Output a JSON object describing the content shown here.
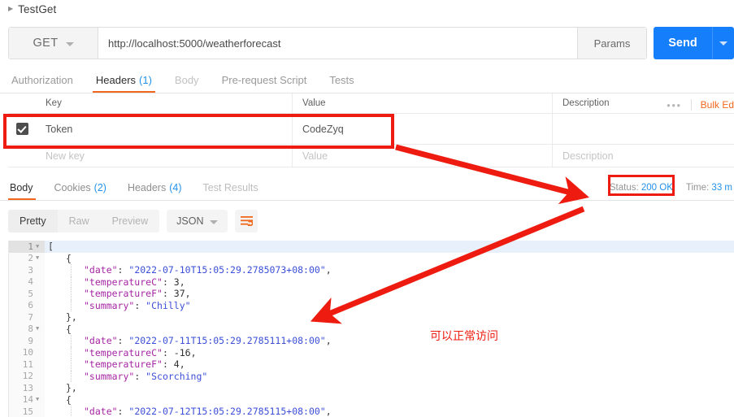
{
  "tabstrip": {
    "caret": "collapse-caret-icon",
    "title": "TestGet"
  },
  "urlbar": {
    "method": "GET",
    "method_caret": "chevron-down-icon",
    "url": "http://localhost:5000/weatherforecast",
    "params_label": "Params",
    "send_label": "Send",
    "send_caret": "chevron-down-icon"
  },
  "request_tabs": [
    {
      "label": "Authorization",
      "count": "",
      "active": false,
      "dim": false
    },
    {
      "label": "Headers",
      "count": "(1)",
      "active": true,
      "dim": false
    },
    {
      "label": "Body",
      "count": "",
      "active": false,
      "dim": true
    },
    {
      "label": "Pre-request Script",
      "count": "",
      "active": false,
      "dim": false
    },
    {
      "label": "Tests",
      "count": "",
      "active": false,
      "dim": false
    }
  ],
  "headers_table": {
    "columns": {
      "key": "Key",
      "value": "Value",
      "description": "Description"
    },
    "more_icon": "ellipsis-icon",
    "bulk_edit_label": "Bulk Ed",
    "rows": [
      {
        "checked": true,
        "key": "Token",
        "value": "CodeZyq",
        "description": ""
      }
    ],
    "new_row": {
      "key_placeholder": "New key",
      "value_placeholder": "Value",
      "description_placeholder": "Description"
    }
  },
  "response_tabs": [
    {
      "label": "Body",
      "count": "",
      "active": true,
      "dim": false
    },
    {
      "label": "Cookies",
      "count": "(2)",
      "active": false,
      "dim": false
    },
    {
      "label": "Headers",
      "count": "(4)",
      "active": false,
      "dim": false
    },
    {
      "label": "Test Results",
      "count": "",
      "active": false,
      "dim": true
    }
  ],
  "response_meta": {
    "status_label": "Status:",
    "status_value": "200 OK",
    "time_label": "Time:",
    "time_value": "33 m"
  },
  "format_bar": {
    "modes": [
      {
        "label": "Pretty",
        "active": true
      },
      {
        "label": "Raw",
        "active": false
      },
      {
        "label": "Preview",
        "active": false
      }
    ],
    "language": "JSON",
    "language_caret": "chevron-down-icon",
    "wrap_icon": "word-wrap-icon"
  },
  "code": {
    "lines": [
      {
        "num": "1",
        "fold": true,
        "highlight": true,
        "indent": 0,
        "tokens": [
          {
            "t": "p",
            "v": "["
          }
        ]
      },
      {
        "num": "2",
        "fold": true,
        "highlight": false,
        "indent": 1,
        "tokens": [
          {
            "t": "p",
            "v": "{"
          }
        ]
      },
      {
        "num": "3",
        "fold": false,
        "highlight": false,
        "indent": 2,
        "tokens": [
          {
            "t": "k",
            "v": "\"date\""
          },
          {
            "t": "p",
            "v": ": "
          },
          {
            "t": "s",
            "v": "\"2022-07-10T15:05:29.2785073+08:00\""
          },
          {
            "t": "p",
            "v": ","
          }
        ]
      },
      {
        "num": "4",
        "fold": false,
        "highlight": false,
        "indent": 2,
        "tokens": [
          {
            "t": "k",
            "v": "\"temperatureC\""
          },
          {
            "t": "p",
            "v": ": "
          },
          {
            "t": "n",
            "v": "3"
          },
          {
            "t": "p",
            "v": ","
          }
        ]
      },
      {
        "num": "5",
        "fold": false,
        "highlight": false,
        "indent": 2,
        "tokens": [
          {
            "t": "k",
            "v": "\"temperatureF\""
          },
          {
            "t": "p",
            "v": ": "
          },
          {
            "t": "n",
            "v": "37"
          },
          {
            "t": "p",
            "v": ","
          }
        ]
      },
      {
        "num": "6",
        "fold": false,
        "highlight": false,
        "indent": 2,
        "tokens": [
          {
            "t": "k",
            "v": "\"summary\""
          },
          {
            "t": "p",
            "v": ": "
          },
          {
            "t": "s",
            "v": "\"Chilly\""
          }
        ]
      },
      {
        "num": "7",
        "fold": false,
        "highlight": false,
        "indent": 1,
        "tokens": [
          {
            "t": "p",
            "v": "},"
          }
        ]
      },
      {
        "num": "8",
        "fold": true,
        "highlight": false,
        "indent": 1,
        "tokens": [
          {
            "t": "p",
            "v": "{"
          }
        ]
      },
      {
        "num": "9",
        "fold": false,
        "highlight": false,
        "indent": 2,
        "tokens": [
          {
            "t": "k",
            "v": "\"date\""
          },
          {
            "t": "p",
            "v": ": "
          },
          {
            "t": "s",
            "v": "\"2022-07-11T15:05:29.2785111+08:00\""
          },
          {
            "t": "p",
            "v": ","
          }
        ]
      },
      {
        "num": "10",
        "fold": false,
        "highlight": false,
        "indent": 2,
        "tokens": [
          {
            "t": "k",
            "v": "\"temperatureC\""
          },
          {
            "t": "p",
            "v": ": "
          },
          {
            "t": "n",
            "v": "-16"
          },
          {
            "t": "p",
            "v": ","
          }
        ]
      },
      {
        "num": "11",
        "fold": false,
        "highlight": false,
        "indent": 2,
        "tokens": [
          {
            "t": "k",
            "v": "\"temperatureF\""
          },
          {
            "t": "p",
            "v": ": "
          },
          {
            "t": "n",
            "v": "4"
          },
          {
            "t": "p",
            "v": ","
          }
        ]
      },
      {
        "num": "12",
        "fold": false,
        "highlight": false,
        "indent": 2,
        "tokens": [
          {
            "t": "k",
            "v": "\"summary\""
          },
          {
            "t": "p",
            "v": ": "
          },
          {
            "t": "s",
            "v": "\"Scorching\""
          }
        ]
      },
      {
        "num": "13",
        "fold": false,
        "highlight": false,
        "indent": 1,
        "tokens": [
          {
            "t": "p",
            "v": "},"
          }
        ]
      },
      {
        "num": "14",
        "fold": true,
        "highlight": false,
        "indent": 1,
        "tokens": [
          {
            "t": "p",
            "v": "{"
          }
        ]
      },
      {
        "num": "15",
        "fold": false,
        "highlight": false,
        "indent": 2,
        "tokens": [
          {
            "t": "k",
            "v": "\"date\""
          },
          {
            "t": "p",
            "v": ": "
          },
          {
            "t": "s",
            "v": "\"2022-07-12T15:05:29.2785115+08:00\""
          },
          {
            "t": "p",
            "v": ","
          }
        ]
      }
    ]
  },
  "annotations": {
    "note_text": "可以正常访问",
    "highlight_color": "#ee1c10",
    "accent_color": "#f1671d",
    "send_color": "#157efb",
    "link_color": "#2492ea"
  }
}
